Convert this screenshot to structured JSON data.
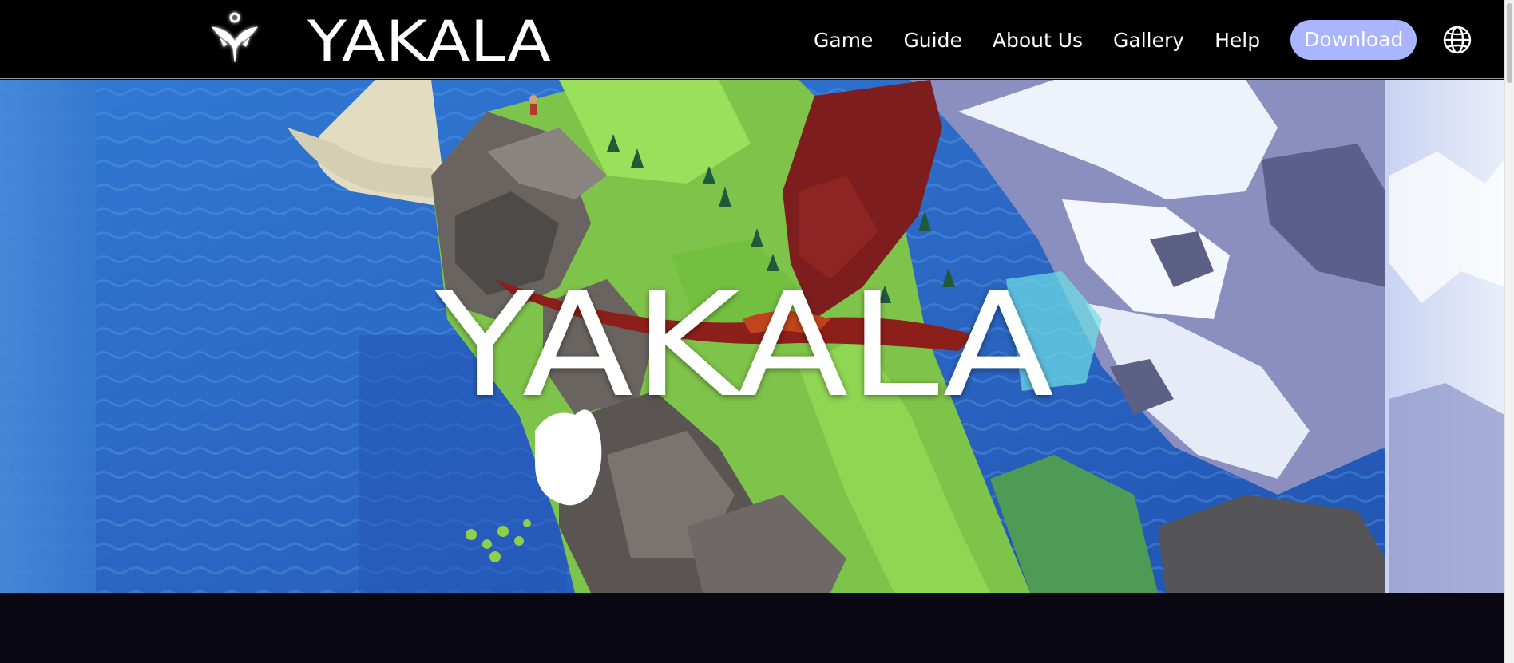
{
  "brand": {
    "emblem_icon": "yakala-emblem-icon",
    "wordmark": "YAKALA"
  },
  "nav": {
    "items": [
      {
        "label": "Game"
      },
      {
        "label": "Guide"
      },
      {
        "label": "About Us"
      },
      {
        "label": "Gallery"
      },
      {
        "label": "Help"
      }
    ],
    "download_label": "Download",
    "language_icon": "globe-icon"
  },
  "hero": {
    "title": "YAKALA",
    "image": "low-poly aerial landscape with dragon"
  },
  "colors": {
    "navbar_bg": "#000000",
    "download_bg": "#a9b6ff",
    "page_bg": "#0a0913",
    "water": "#2f6fc9",
    "grass": "#7cc94a",
    "dragon": "#8a1c1c",
    "snow": "#e8eef8"
  }
}
